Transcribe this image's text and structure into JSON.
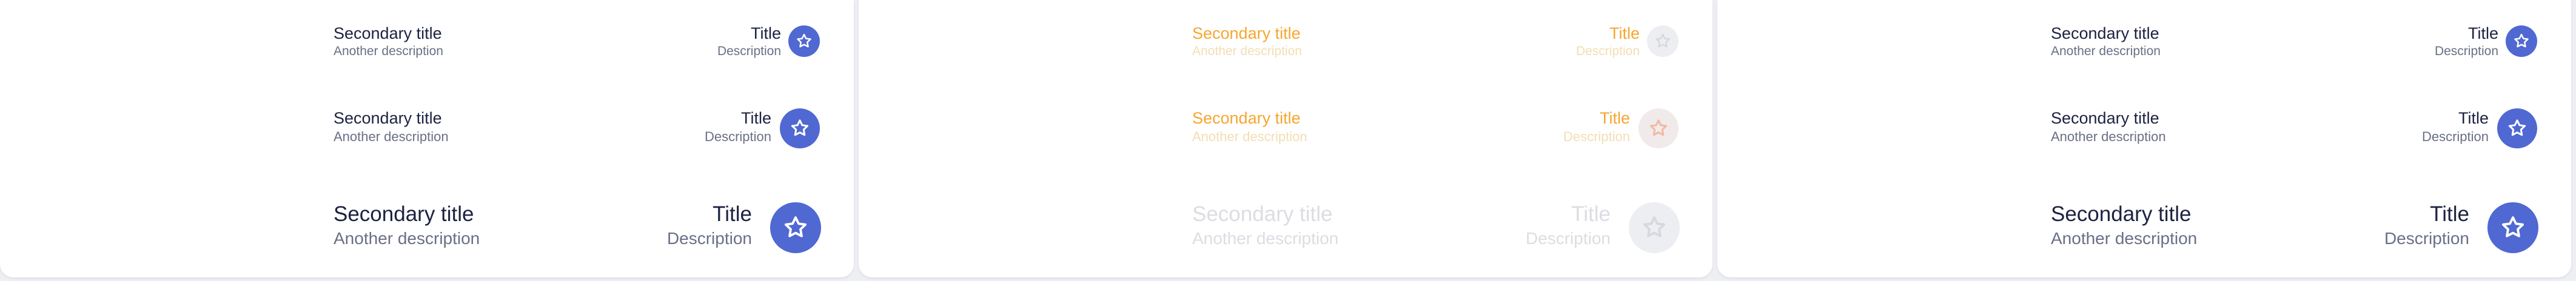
{
  "panels": [
    {
      "state": "default",
      "rows": [
        {
          "size": "small",
          "secondary_title": "Secondary title",
          "secondary_description": "Another description",
          "title": "Title",
          "description": "Description",
          "icon": "star-icon"
        },
        {
          "size": "medium",
          "secondary_title": "Secondary title",
          "secondary_description": "Another description",
          "title": "Title",
          "description": "Description",
          "icon": "star-icon"
        },
        {
          "size": "large",
          "secondary_title": "Secondary title",
          "secondary_description": "Another description",
          "title": "Title",
          "description": "Description",
          "icon": "star-icon"
        }
      ]
    },
    {
      "state": "loading",
      "rows": [
        {
          "size": "small",
          "secondary_title": "Secondary title",
          "secondary_description": "Another description",
          "title": "Title",
          "description": "Description",
          "icon": "star-icon"
        },
        {
          "size": "medium",
          "secondary_title": "Secondary title",
          "secondary_description": "Another description",
          "title": "Title",
          "description": "Description",
          "icon": "star-icon"
        },
        {
          "size": "large",
          "secondary_title": "Secondary title",
          "secondary_description": "Another description",
          "title": "Title",
          "description": "Description",
          "icon": "star-icon"
        }
      ]
    },
    {
      "state": "default",
      "rows": [
        {
          "size": "small",
          "secondary_title": "Secondary title",
          "secondary_description": "Another description",
          "title": "Title",
          "description": "Description",
          "icon": "star-icon"
        },
        {
          "size": "medium",
          "secondary_title": "Secondary title",
          "secondary_description": "Another description",
          "title": "Title",
          "description": "Description",
          "icon": "star-icon"
        },
        {
          "size": "large",
          "secondary_title": "Secondary title",
          "secondary_description": "Another description",
          "title": "Title",
          "description": "Description",
          "icon": "star-icon"
        }
      ]
    }
  ],
  "colors": {
    "accent": "#5068d2",
    "loading_text": "#f6a630",
    "background": "#eeeff3",
    "panel": "#ffffff"
  }
}
